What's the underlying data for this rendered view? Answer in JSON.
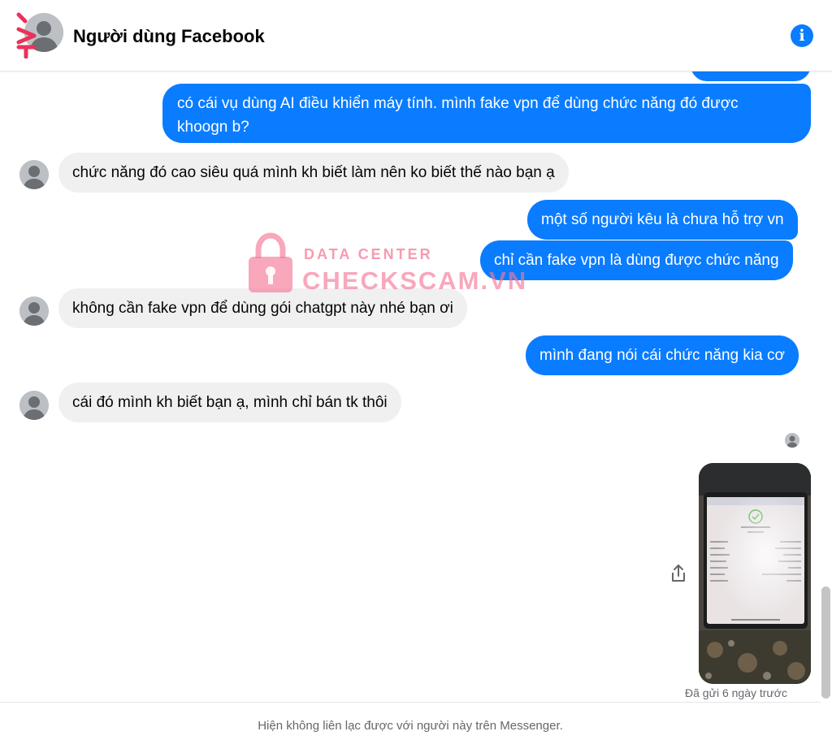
{
  "header": {
    "contact_name": "Người dùng Facebook",
    "info_icon": "info-icon",
    "info_glyph": "i"
  },
  "messages": [
    {
      "direction": "outgoing",
      "text_line1": "có cái vụ dùng AI điều khiển máy tính. mình fake vpn để dùng chức năng đó được",
      "text_line2": "khoogn b?"
    },
    {
      "direction": "incoming",
      "text": "chức năng đó cao siêu quá mình kh biết làm nên ko biết thế nào bạn ạ"
    },
    {
      "direction": "outgoing",
      "text": "một số người kêu là chưa hỗ trợ vn"
    },
    {
      "direction": "outgoing",
      "text": "chỉ cần fake vpn là dùng được chức năng"
    },
    {
      "direction": "incoming",
      "text": "không cần fake vpn để dùng gói chatgpt này nhé bạn ơi"
    },
    {
      "direction": "outgoing",
      "text": "mình đang nói cái chức năng kia cơ"
    },
    {
      "direction": "incoming",
      "text": "cái đó mình kh biết bạn ạ, mình chỉ bán tk thôi"
    }
  ],
  "attachment": {
    "type": "photo",
    "share_icon": "share-icon",
    "status": "Đã gửi 6 ngày trước"
  },
  "footer": {
    "notice": "Hiện không liên lạc được với người này trên Messenger."
  },
  "watermark": {
    "line1": "DATA CENTER",
    "line2": "CHECKSCAM.VN",
    "icon": "lock-icon"
  },
  "colors": {
    "outgoing_bubble": "#0a7cff",
    "incoming_bubble": "#f0f0f0",
    "watermark": "#f678a0",
    "secondary_text": "#65676b"
  }
}
